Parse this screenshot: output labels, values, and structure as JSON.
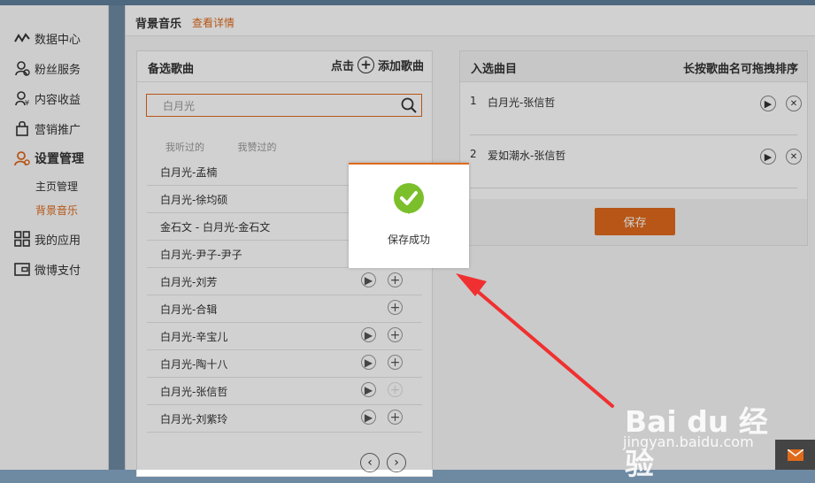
{
  "sidebar": {
    "items": [
      {
        "label": "数据中心",
        "icon": "chart-line-icon"
      },
      {
        "label": "粉丝服务",
        "icon": "fans-icon"
      },
      {
        "label": "内容收益",
        "icon": "revenue-icon"
      },
      {
        "label": "营销推广",
        "icon": "bag-icon"
      },
      {
        "label": "设置管理",
        "icon": "user-settings-icon",
        "active": true
      },
      {
        "label": "我的应用",
        "icon": "grid-icon"
      },
      {
        "label": "微博支付",
        "icon": "wallet-icon"
      }
    ],
    "sub_items": [
      {
        "label": "主页管理"
      },
      {
        "label": "背景音乐",
        "active": true
      }
    ]
  },
  "header": {
    "title": "背景音乐",
    "link": "查看详情"
  },
  "candidate": {
    "title": "备选歌曲",
    "add_prefix": "点击",
    "add_label": "添加歌曲",
    "search_value": "白月光",
    "tabs": [
      "我听过的",
      "我赞过的"
    ],
    "songs": [
      {
        "name": "白月光-孟楠"
      },
      {
        "name": "白月光-徐均硕"
      },
      {
        "name": "金石文 - 白月光-金石文"
      },
      {
        "name": "白月光-尹子-尹子"
      },
      {
        "name": "白月光-刘芳"
      },
      {
        "name": "白月光-合辑"
      },
      {
        "name": "白月光-辛宝儿"
      },
      {
        "name": "白月光-陶十八"
      },
      {
        "name": "白月光-张信哲"
      },
      {
        "name": "白月光-刘紫玲"
      }
    ]
  },
  "selected": {
    "title": "入选曲目",
    "hint": "长按歌曲名可拖拽排序",
    "songs": [
      {
        "num": "1",
        "name": "白月光-张信哲"
      },
      {
        "num": "2",
        "name": "爱如潮水-张信哲"
      }
    ],
    "save_label": "保存"
  },
  "toast": {
    "message": "保存成功"
  },
  "watermark": {
    "logo": "Bai du 经验",
    "url": "jingyan.baidu.com"
  },
  "colors": {
    "accent": "#e06a1b",
    "success": "#7bbf2b"
  }
}
